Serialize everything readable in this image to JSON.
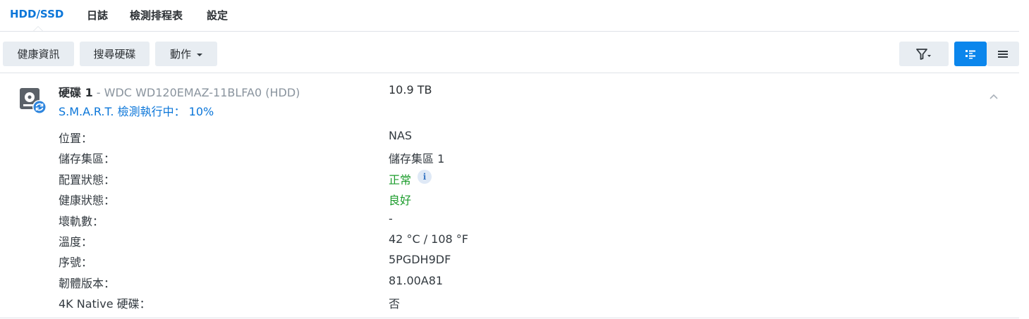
{
  "tabs": [
    {
      "label": "HDD/SSD",
      "active": true
    },
    {
      "label": "日誌",
      "active": false
    },
    {
      "label": "檢測排程表",
      "active": false
    },
    {
      "label": "設定",
      "active": false
    }
  ],
  "toolbar": {
    "health_info": "健康資訊",
    "search_disk": "搜尋硬碟",
    "action": "動作"
  },
  "disk": {
    "name": "硬碟 1",
    "model": " - WDC WD120EMAZ-11BLFA0 (HDD)",
    "size": "10.9 TB",
    "smart_status": "S.M.A.R.T. 檢測執行中： 10%"
  },
  "details": [
    {
      "label": "位置：",
      "value": "NAS"
    },
    {
      "label": "儲存集區：",
      "value": "儲存集區 1"
    },
    {
      "label": "配置狀態：",
      "value": "正常"
    },
    {
      "label": "健康狀態：",
      "value": "良好"
    },
    {
      "label": "壞軌數：",
      "value": "-"
    },
    {
      "label": "溫度：",
      "value": "42 °C / 108 °F"
    },
    {
      "label": "序號：",
      "value": "5PGDH9DF"
    },
    {
      "label": "韌體版本：",
      "value": "81.00A81"
    },
    {
      "label": "4K Native 硬碟：",
      "value": "否"
    }
  ],
  "info_icon_glyph": "i",
  "colors": {
    "accent": "#0b76d9",
    "status_good": "#1c9c2c",
    "button_bg": "#e8edf2",
    "primary_button_bg": "#0b86ec"
  }
}
